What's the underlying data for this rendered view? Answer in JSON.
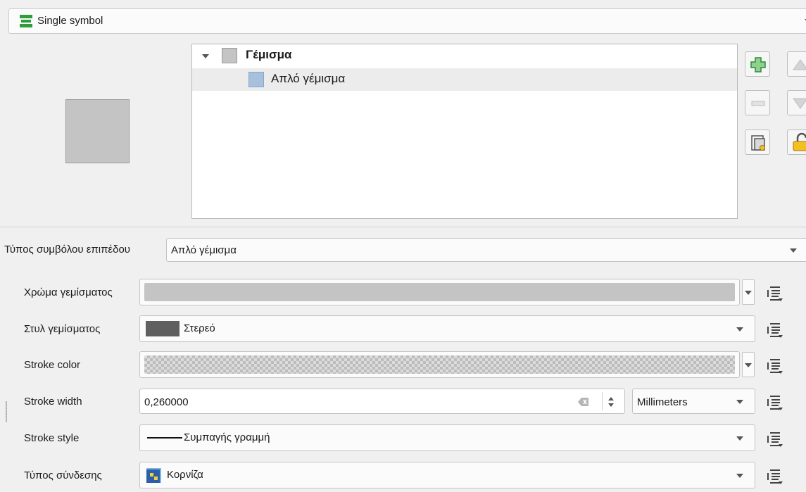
{
  "renderer": {
    "label": "Single symbol"
  },
  "symbol_tree": {
    "root_label": "Γέμισμα",
    "child_label": "Απλό γέμισμα"
  },
  "layer_type": {
    "label": "Τύπος συμβόλου επιπέδου",
    "value": "Απλό γέμισμα"
  },
  "fields": {
    "fill_color": {
      "label": "Χρώμα γεμίσματος",
      "color": "#c4c4c4"
    },
    "fill_style": {
      "label": "Στυλ γεμίσματος",
      "value": "Στερεό",
      "swatch_color": "#5f5f5f"
    },
    "stroke_color": {
      "label": "Stroke color",
      "pattern": "transparent-checkerboard"
    },
    "stroke_width": {
      "label": "Stroke width",
      "value": "0,260000",
      "unit": "Millimeters"
    },
    "stroke_style": {
      "label": "Stroke style",
      "value": "Συμπαγής γραμμή"
    },
    "join_style": {
      "label": "Τύπος σύνδεσης",
      "value": "Κορνίζα"
    }
  },
  "colors": {
    "accent_green": "#2e9e3a",
    "selection_bg": "#ececec",
    "tree_child_swatch": "#a7c0dc",
    "tree_root_swatch": "#c4c4c4"
  },
  "icons": {
    "renderer": "single-symbol-icon",
    "add": "add-layer-icon",
    "remove": "remove-layer-icon",
    "up": "move-up-icon",
    "down": "move-down-icon",
    "duplicate": "duplicate-layer-icon",
    "lock": "lock-icon",
    "data_defined": "data-defined-override-icon"
  }
}
